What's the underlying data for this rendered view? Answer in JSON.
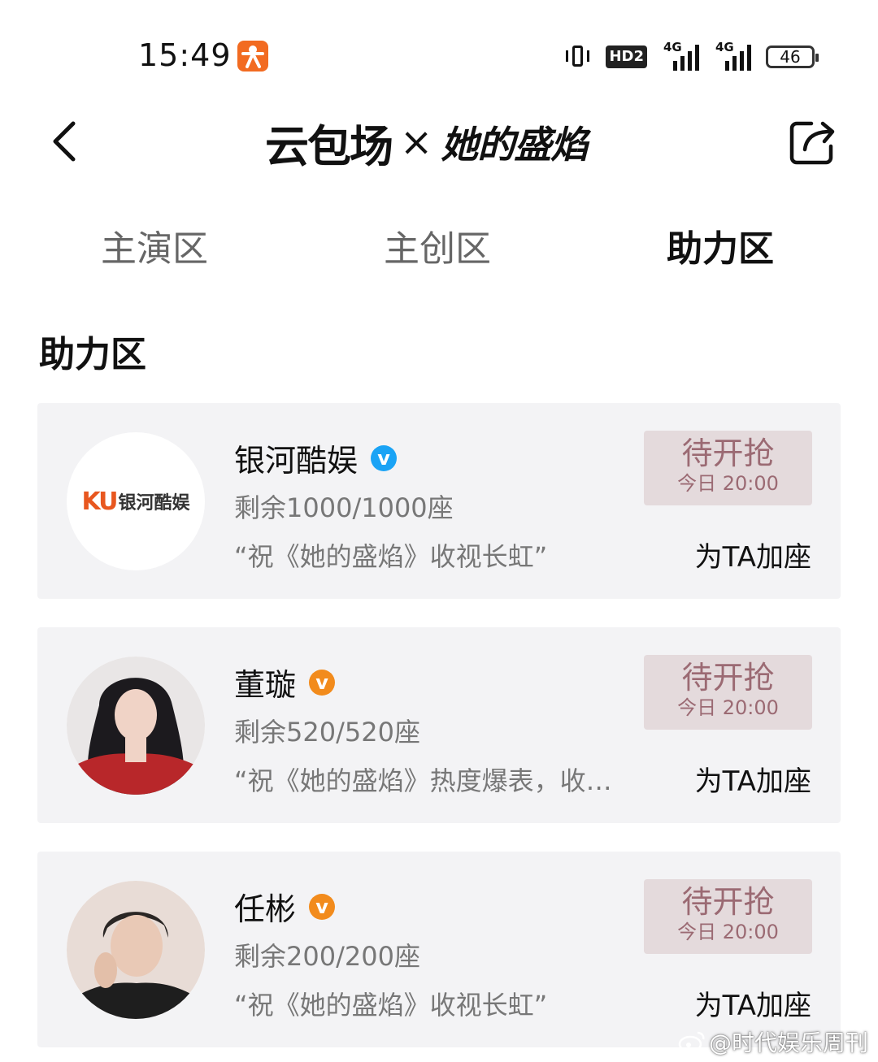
{
  "status_bar": {
    "time": "15:49",
    "hd_label": "HD2",
    "network1": "4G",
    "network2": "4G",
    "battery": "46"
  },
  "header": {
    "logo_left": "云包场",
    "logo_x": "×",
    "logo_right": "她的盛焰"
  },
  "tabs": [
    {
      "label": "主演区",
      "active": false
    },
    {
      "label": "主创区",
      "active": false
    },
    {
      "label": "助力区",
      "active": true
    }
  ],
  "section_title": "助力区",
  "cards": [
    {
      "name": "银河酷娱",
      "avatar_logo_mark": "KU",
      "avatar_logo_text": "银河酷娱",
      "verified": "blue",
      "seats": "剩余1000/1000座",
      "quote": "“祝《她的盛焰》收视长虹”",
      "status": "待开抢",
      "time": "今日 20:00",
      "action": "为TA加座"
    },
    {
      "name": "董璇",
      "verified": "orange",
      "seats": "剩余520/520座",
      "quote": "“祝《她的盛焰》热度爆表，收…",
      "status": "待开抢",
      "time": "今日 20:00",
      "action": "为TA加座"
    },
    {
      "name": "任彬",
      "verified": "orange",
      "seats": "剩余200/200座",
      "quote": "“祝《她的盛焰》收视长虹”",
      "status": "待开抢",
      "time": "今日 20:00",
      "action": "为TA加座"
    }
  ],
  "watermark": "@时代娱乐周刊",
  "colors": {
    "card_bg": "#f3f3f5",
    "grab_bg": "#e4dadc",
    "grab_text": "#9b6a73",
    "verified_blue": "#1aa3f5",
    "verified_orange": "#f28b1c",
    "ku_orange": "#e8571f"
  }
}
